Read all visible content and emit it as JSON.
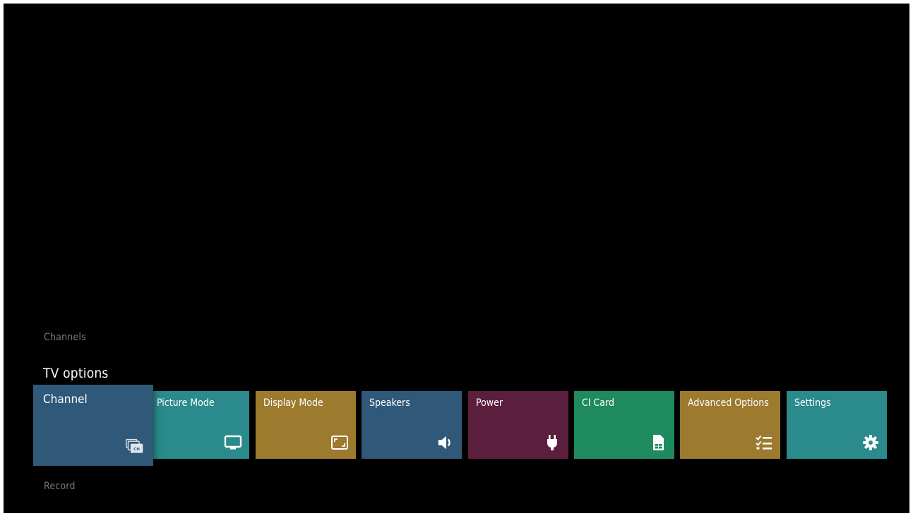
{
  "menu": {
    "section_above": "Channels",
    "section_title": "TV options",
    "section_below": "Record",
    "tiles": [
      {
        "label": "Channel",
        "icon": "channel-list-icon",
        "color": "#2f5879",
        "focused": true
      },
      {
        "label": "Picture Mode",
        "icon": "monitor-icon",
        "color": "#2b8a8b"
      },
      {
        "label": "Display Mode",
        "icon": "aspect-ratio-icon",
        "color": "#9c7a2e"
      },
      {
        "label": "Speakers",
        "icon": "speaker-icon",
        "color": "#2f5879"
      },
      {
        "label": "Power",
        "icon": "power-plug-icon",
        "color": "#5c1e3d"
      },
      {
        "label": "CI Card",
        "icon": "sim-card-icon",
        "color": "#1f8a5d"
      },
      {
        "label": "Advanced Options",
        "icon": "checklist-icon",
        "color": "#9c7a2e"
      },
      {
        "label": "Settings",
        "icon": "gear-icon",
        "color": "#2b8a8b"
      }
    ]
  }
}
